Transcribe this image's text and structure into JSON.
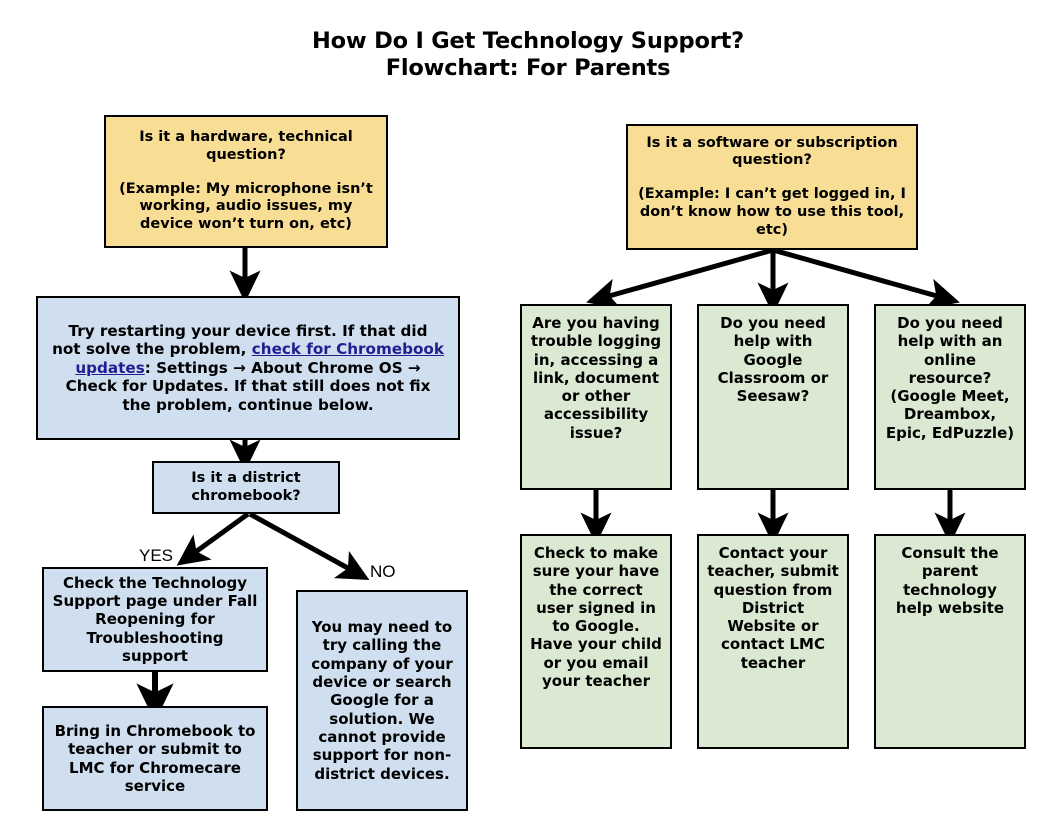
{
  "title": {
    "line1": "How Do I Get Technology Support?",
    "line2": "Flowchart: For Parents"
  },
  "colors": {
    "yellow": "#f8dd95",
    "blue": "#cfdff0",
    "green": "#dbe9d2",
    "border": "#000000",
    "link": "#1f1f8f",
    "background": "#ffffff"
  },
  "left_branch": {
    "start": {
      "question": "Is it a hardware, technical question?",
      "example": "(Example: My microphone isn’t working, audio issues, my device won’t turn on, etc)"
    },
    "restart": {
      "text_before_link": "Try restarting your device first. If that did not solve the problem, ",
      "link_text": "check for Chromebook updates",
      "text_after_link": ":  Settings → About Chrome OS → Check for Updates. If that still does not fix the problem, continue below."
    },
    "decision": "Is it a district chromebook?",
    "yes_label": "YES",
    "no_label": "NO",
    "yes_step1": "Check the Technology Support page under Fall Reopening for Troubleshooting support",
    "yes_step2": "Bring in Chromebook to teacher or submit to LMC for Chromecare service",
    "no_step1": "You may need to try calling the company of your device or search Google for a solution. We cannot provide support for non-district devices."
  },
  "right_branch": {
    "start": {
      "question": "Is it a software or subscription question?",
      "example": "(Example: I can’t get logged in, I don’t know how to use this tool, etc)"
    },
    "questions": [
      "Are you having trouble logging in, accessing a link, document or other accessibility issue?",
      "Do you need help with Google Classroom or Seesaw?",
      "Do you need help with an online resource? (Google Meet, Dreambox, Epic, EdPuzzle)"
    ],
    "answers": [
      "Check to make sure your have the correct user signed in to Google. Have your child or you email your teacher",
      "Contact your teacher, submit question from District Website or contact LMC teacher",
      "Consult the parent technology help website"
    ]
  }
}
